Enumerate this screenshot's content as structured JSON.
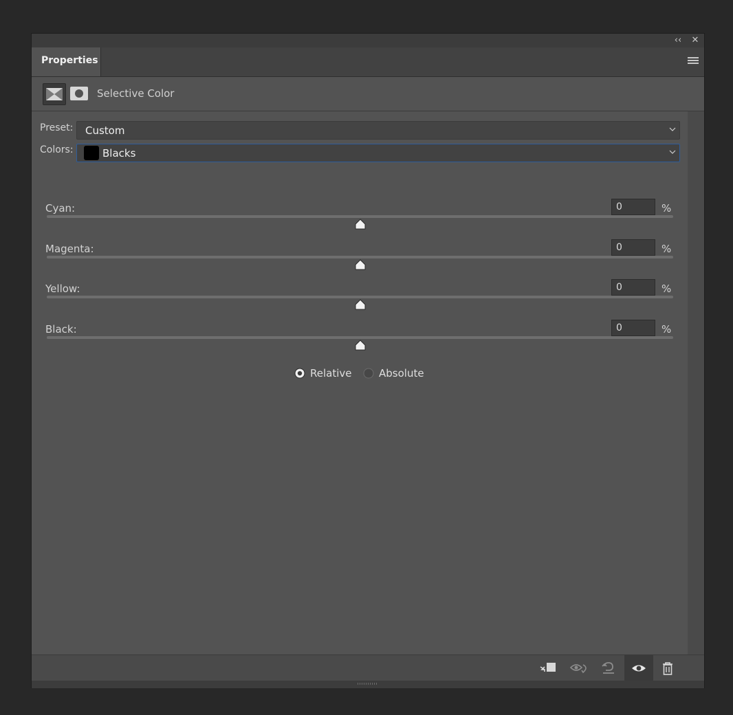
{
  "panel": {
    "tab_label": "Properties",
    "collapse_glyph": "‹‹",
    "close_glyph": "✕"
  },
  "header": {
    "title": "Selective Color"
  },
  "preset": {
    "label": "Preset:",
    "value": "Custom"
  },
  "colors": {
    "label": "Colors:",
    "value": "Blacks",
    "swatch_color": "#000000"
  },
  "sliders": [
    {
      "label": "Cyan:",
      "value": "0",
      "unit": "%",
      "level": 0
    },
    {
      "label": "Magenta:",
      "value": "0",
      "unit": "%",
      "level": 0
    },
    {
      "label": "Yellow:",
      "value": "0",
      "unit": "%",
      "level": 0
    },
    {
      "label": "Black:",
      "value": "0",
      "unit": "%",
      "level": 0
    }
  ],
  "method": {
    "relative_label": "Relative",
    "absolute_label": "Absolute",
    "selected": "Relative"
  },
  "footer_icons": [
    "clip-to-layer-icon",
    "view-previous-state-icon",
    "reset-icon",
    "visibility-eye-icon",
    "trash-icon"
  ],
  "colors_theme": {
    "panel_bg": "#535353",
    "focus_border": "#2e5d9c"
  }
}
